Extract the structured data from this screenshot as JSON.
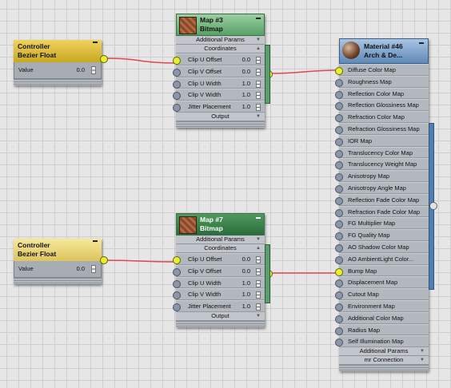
{
  "controllers": [
    {
      "title_line1": "Controller",
      "title_line2": "Bezier Float",
      "param_label": "Value",
      "param_value": "0.0"
    },
    {
      "title_line1": "Controller",
      "title_line2": "Bezier Float",
      "param_label": "Value",
      "param_value": "0.0"
    }
  ],
  "maps": [
    {
      "title_line1": "Map #3",
      "title_line2": "Bitmap",
      "sections": {
        "additional": "Additional Params",
        "coordinates": "Coordinates",
        "output": "Output"
      },
      "params": [
        {
          "label": "Clip U Offset",
          "value": "0.0"
        },
        {
          "label": "Clip V Offset",
          "value": "0.0"
        },
        {
          "label": "Clip U Width",
          "value": "1.0"
        },
        {
          "label": "Clip V Width",
          "value": "1.0"
        },
        {
          "label": "Jitter Placement",
          "value": "1.0"
        }
      ]
    },
    {
      "title_line1": "Map #7",
      "title_line2": "Bitmap",
      "sections": {
        "additional": "Additional Params",
        "coordinates": "Coordinates",
        "output": "Output"
      },
      "params": [
        {
          "label": "Clip U Offset",
          "value": "0.0"
        },
        {
          "label": "Clip V Offset",
          "value": "0.0"
        },
        {
          "label": "Clip U Width",
          "value": "1.0"
        },
        {
          "label": "Clip V Width",
          "value": "1.0"
        },
        {
          "label": "Jitter Placement",
          "value": "1.0"
        }
      ]
    }
  ],
  "material": {
    "title_line1": "Material #46",
    "title_line2": "Arch & De...",
    "slots": [
      "Diffuse Color Map",
      "Roughness Map",
      "Reflection Color Map",
      "Reflection Glossiness Map",
      "Refraction Color Map",
      "Refraction Glossiness Map",
      "IOR Map",
      "Translucency Color Map",
      "Translucency Weight Map",
      "Anisotropy Map",
      "Anisotropy Angle Map",
      "Reflection Fade Color Map",
      "Refraction Fade Color Map",
      "FG Multiplier Map",
      "FG Quality Map",
      "AO Shadow Color Map",
      "AO AmbientLight Color...",
      "Bump Map",
      "Displacement Map",
      "Cutout Map",
      "Environment Map",
      "Additional Color Map",
      "Radius Map",
      "Self Illumination Map"
    ],
    "sections": {
      "additional": "Additional Params",
      "connection": "mr Connection"
    }
  },
  "colors": {
    "wire": "#e0474e",
    "socket_connected": "#e9f02a",
    "socket_empty": "#8b96a8"
  }
}
